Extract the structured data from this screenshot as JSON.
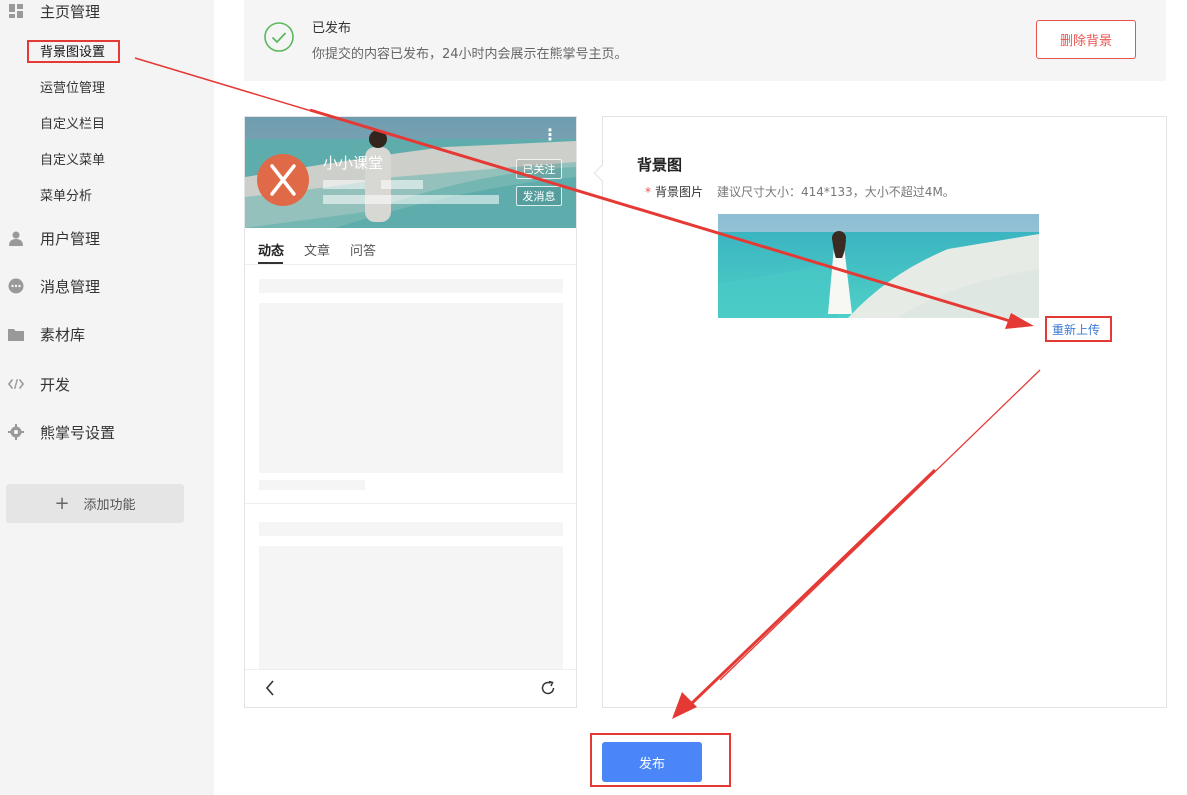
{
  "sidebar": {
    "home_label": "主页管理",
    "sub_items": [
      {
        "label": "背景图设置"
      },
      {
        "label": "运营位管理"
      },
      {
        "label": "自定义栏目"
      },
      {
        "label": "自定义菜单"
      },
      {
        "label": "菜单分析"
      }
    ],
    "items": [
      {
        "label": "用户管理",
        "icon": "user-icon"
      },
      {
        "label": "消息管理",
        "icon": "message-icon"
      },
      {
        "label": "素材库",
        "icon": "folder-icon"
      },
      {
        "label": "开发",
        "icon": "code-icon"
      },
      {
        "label": "熊掌号设置",
        "icon": "gear-icon"
      }
    ],
    "add_label": "添加功能"
  },
  "status": {
    "title": "已发布",
    "desc": "你提交的内容已发布，24小时内会展示在熊掌号主页。",
    "delete_label": "删除背景",
    "accent": "#e9534e"
  },
  "phone": {
    "name": "小小课堂",
    "follow_label": "已关注",
    "message_label": "发消息",
    "tabs": [
      {
        "label": "动态"
      },
      {
        "label": "文章"
      },
      {
        "label": "问答"
      }
    ]
  },
  "panel": {
    "title": "背景图",
    "required_mark": "*",
    "field_label": "背景图片",
    "hint": "建议尺寸大小：414*133，大小不超过4M。",
    "reupload_label": "重新上传"
  },
  "publish_label": "发布",
  "colors": {
    "primary": "#4a86f7",
    "annotation": "#e53935",
    "success": "#5cb85c"
  }
}
